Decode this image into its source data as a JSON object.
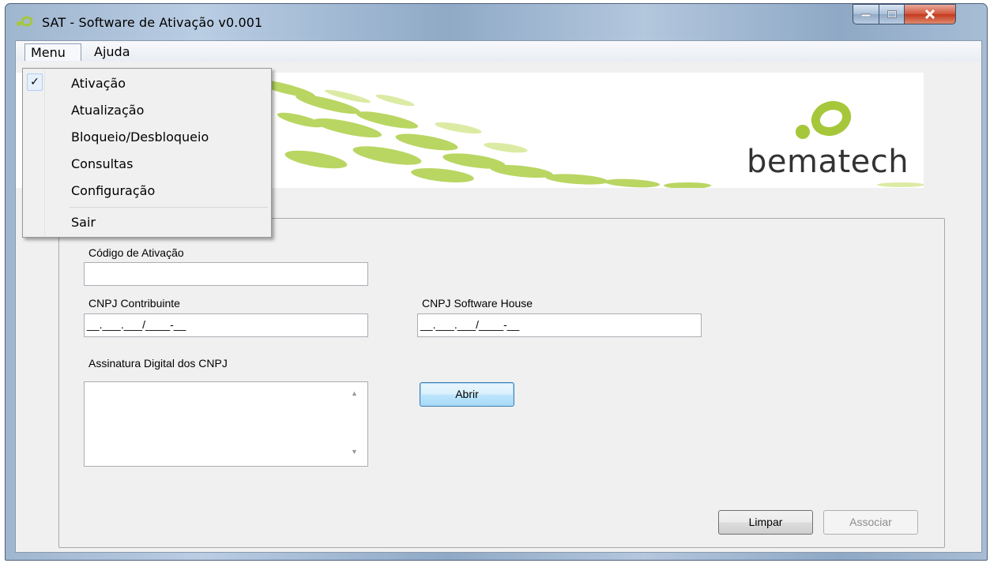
{
  "window": {
    "title": "SAT - Software de Ativação v0.001"
  },
  "menubar": {
    "items": [
      {
        "label": "Menu"
      },
      {
        "label": "Ajuda"
      }
    ]
  },
  "menu_dropdown": {
    "items": [
      {
        "label": "Ativação",
        "checked": true
      },
      {
        "label": "Atualização"
      },
      {
        "label": "Bloqueio/Desbloqueio"
      },
      {
        "label": "Consultas"
      },
      {
        "label": "Configuração"
      },
      {
        "label": "Sair"
      }
    ]
  },
  "banner": {
    "logo_text": "bematech",
    "brand_green": "#a6c73a"
  },
  "form": {
    "codigo_label": "Código de Ativação",
    "codigo_value": "",
    "cnpj_contribuinte_label": "CNPJ Contribuinte",
    "cnpj_contribuinte_value": "__.___.___/____-__",
    "cnpj_software_label": "CNPJ Software House",
    "cnpj_software_value": "__.___.___/____-__",
    "assinatura_label": "Assinatura Digital dos CNPJ",
    "assinatura_value": ""
  },
  "buttons": {
    "abrir": "Abrir",
    "limpar": "Limpar",
    "associar": "Associar"
  }
}
